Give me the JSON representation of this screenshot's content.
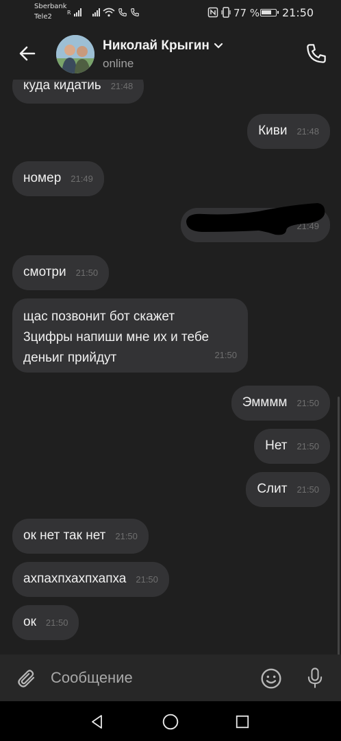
{
  "status_bar": {
    "carrier_primary": "Sberbank",
    "carrier_secondary": "Tele2",
    "battery_percent": "77 %",
    "battery_level": 0.77,
    "time": "21:50"
  },
  "header": {
    "contact_name": "Николай Крыгин",
    "presence": "online"
  },
  "messages": [
    {
      "text": "куда кидатиь",
      "time": "21:48",
      "direction": "incoming"
    },
    {
      "text": "Киви",
      "time": "21:48",
      "direction": "outgoing"
    },
    {
      "text": "номер",
      "time": "21:49",
      "direction": "incoming"
    },
    {
      "text": "",
      "time": "21:49",
      "direction": "outgoing",
      "redacted": true
    },
    {
      "text": "смотри",
      "time": "21:50",
      "direction": "incoming"
    },
    {
      "lines": [
        "щас позвонит бот скажет",
        "3цифры напиши мне их и тебе",
        "деньиг прийдут"
      ],
      "time": "21:50",
      "direction": "incoming"
    },
    {
      "text": "Эмммм",
      "time": "21:50",
      "direction": "outgoing"
    },
    {
      "text": "Нет",
      "time": "21:50",
      "direction": "outgoing"
    },
    {
      "text": "Слит",
      "time": "21:50",
      "direction": "outgoing"
    },
    {
      "text": "ок нет так нет",
      "time": "21:50",
      "direction": "incoming"
    },
    {
      "text": "ахпахпхахпхапха",
      "time": "21:50",
      "direction": "incoming"
    },
    {
      "text": "ок",
      "time": "21:50",
      "direction": "incoming"
    }
  ],
  "composer": {
    "placeholder": "Сообщение"
  },
  "icons": {
    "back": "arrow-left-icon",
    "call": "phone-icon",
    "attach": "paperclip-icon",
    "emoji": "smiley-icon",
    "mic": "microphone-icon",
    "nav_back": "triangle-back-icon",
    "nav_home": "circle-home-icon",
    "nav_recents": "square-recents-icon"
  },
  "colors": {
    "background": "#1f1f1f",
    "bubble": "#333335",
    "timestamp": "#6f6f6f"
  }
}
